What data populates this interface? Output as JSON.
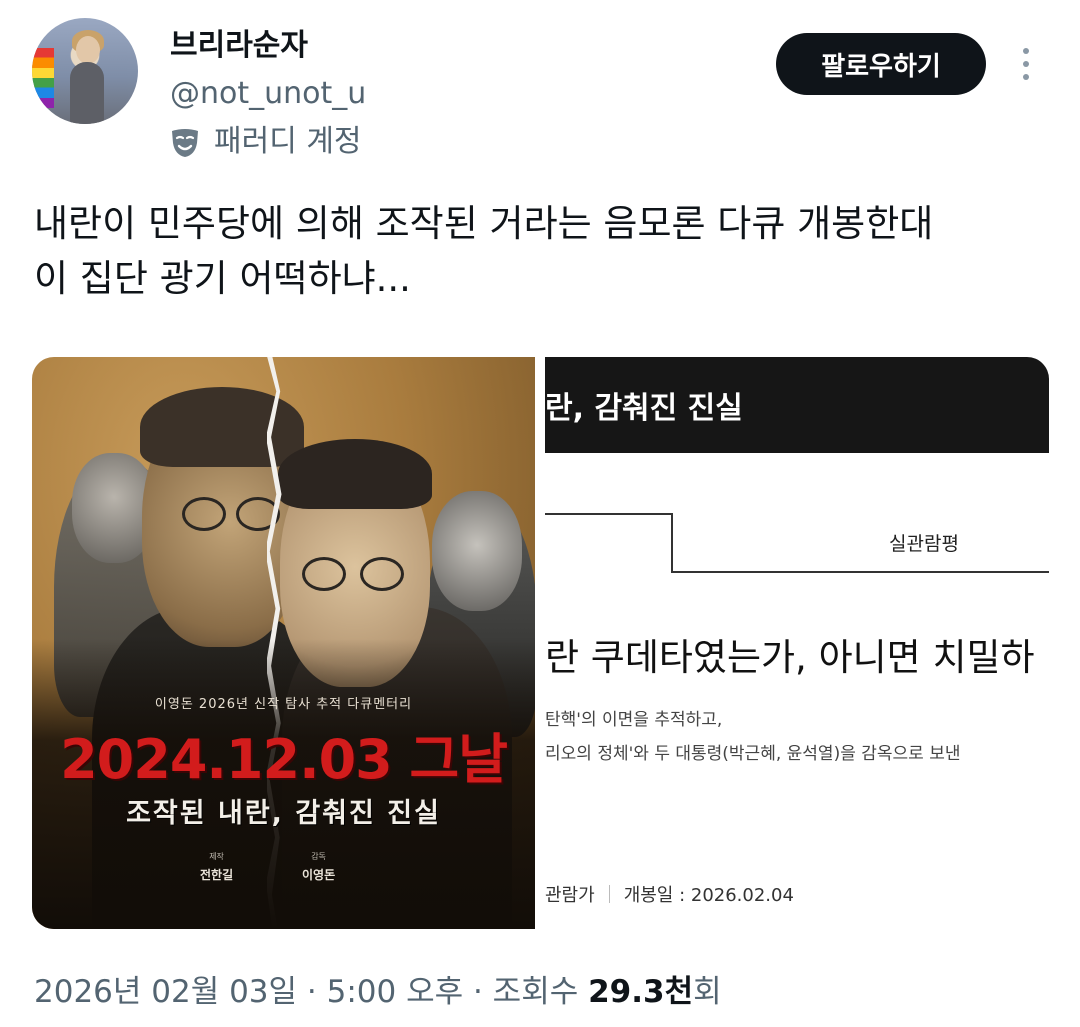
{
  "user": {
    "display_name": "브리라순자",
    "handle": "@not_unot_u",
    "badge_label": "패러디 계정",
    "badge_icon": "theater-mask-icon"
  },
  "actions": {
    "follow_label": "팔로우하기",
    "more_icon": "more-vertical-icon"
  },
  "tweet": {
    "lines": [
      "내란이 민주당에 의해 조작된 거라는 음모론 다큐 개봉한대",
      "이 집단 광기 어떡하냐..."
    ]
  },
  "media": {
    "poster": {
      "subtitle": "이영돈 2026년 신작 탐사 추적 다큐멘터리",
      "title": "2024.12.03 그날",
      "tagline": "조작된 내란, 감춰진 진실",
      "credit1_role": "제작",
      "credit1_name": "전한길",
      "credit2_role": "감독",
      "credit2_name": "이영돈"
    },
    "webpage": {
      "topbar_title": "란, 감춰진 진실",
      "tab_label": "실관람평",
      "headline": "란 쿠데타였는가, 아니면 치밀하",
      "body_line1": "탄핵'의 이면을 추적하고,",
      "body_line2": "리오의 정체'와 두 대통령(박근혜, 윤석열)을 감옥으로 보낸 ",
      "meta_left": "관람가",
      "meta_right": "개봉일 : 2026.02.04"
    }
  },
  "footer": {
    "datetime": "2026년 02월 03일 · 5:00 오후 · 조회수 ",
    "views": "29.3천",
    "views_suffix": "회"
  },
  "colors": {
    "text_primary": "#0f1419",
    "text_secondary": "#536471",
    "follow_button_bg": "#0f1419",
    "poster_title_red": "#d21c1c"
  }
}
